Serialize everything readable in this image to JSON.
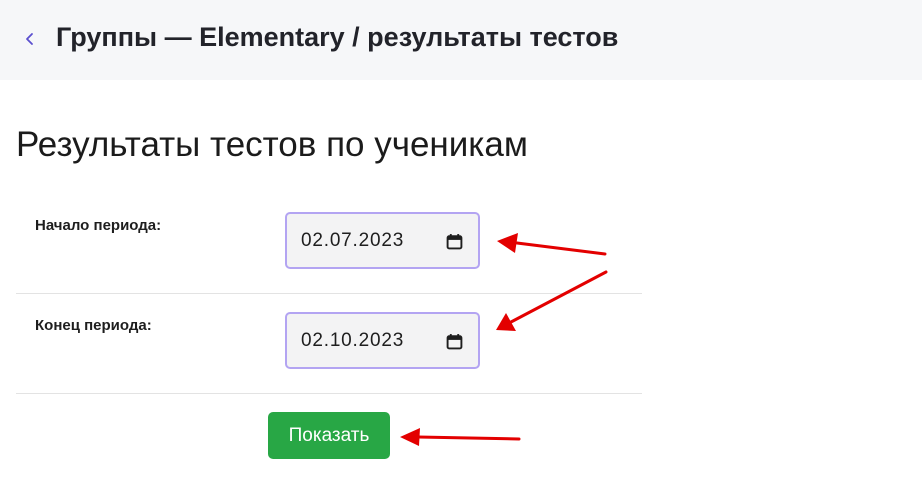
{
  "header": {
    "back_icon": "chevron-left-icon",
    "title": "Группы — Elementary / результаты тестов"
  },
  "main": {
    "title": "Результаты тестов по ученикам",
    "filters": [
      {
        "label": "Начало периода:",
        "value": "02.07.2023",
        "icon": "calendar-icon"
      },
      {
        "label": "Конец периода:",
        "value": "02.10.2023",
        "icon": "calendar-icon"
      }
    ],
    "submit_label": "Показать"
  },
  "colors": {
    "header_bg": "#f6f7f9",
    "input_border": "#b3a4f2",
    "button": "#28a745",
    "annotation_arrow": "#e30000"
  }
}
